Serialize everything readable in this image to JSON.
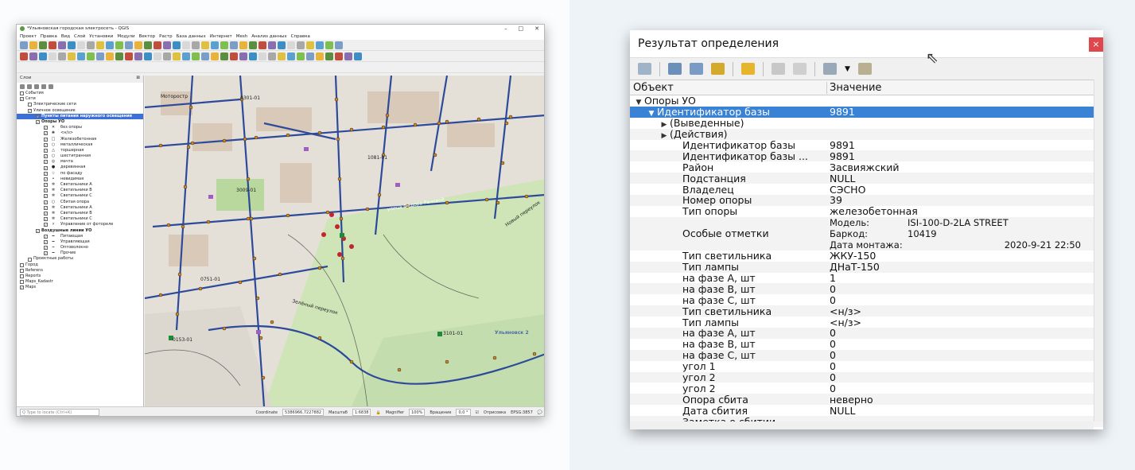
{
  "qgis": {
    "window_title": "*Ульяновская городская электросеть - QGIS",
    "menu": [
      "Проект",
      "Правка",
      "Вид",
      "Слой",
      "Установки",
      "Модули",
      "Вектор",
      "Растр",
      "База данных",
      "Интернет",
      "Mesh",
      "Анализ данных",
      "Справка"
    ],
    "panel_title": "Слои",
    "layers": [
      {
        "label": "События",
        "indent": 0,
        "sym": "",
        "check": ""
      },
      {
        "label": "Сети",
        "indent": 0,
        "sym": "",
        "check": "✓"
      },
      {
        "label": "Электрические сети",
        "indent": 1,
        "sym": "",
        "check": ""
      },
      {
        "label": "Уличное освещение",
        "indent": 1,
        "sym": "",
        "check": "✓"
      },
      {
        "label": "Пункты питания наружного освещения",
        "indent": 2,
        "sym": "",
        "check": "✓",
        "selected": true
      },
      {
        "label": "Опоры УО",
        "indent": 2,
        "sym": "",
        "check": "✓",
        "bold": true
      },
      {
        "label": "без опоры",
        "indent": 3,
        "sym": "✕",
        "check": "✓"
      },
      {
        "label": "<н/з>",
        "indent": 3,
        "sym": "❀",
        "check": "✓"
      },
      {
        "label": "Железобетонная",
        "indent": 3,
        "sym": "□",
        "check": "✓"
      },
      {
        "label": "металлическая",
        "indent": 3,
        "sym": "○",
        "check": "✓"
      },
      {
        "label": "торшерная",
        "indent": 3,
        "sym": "△",
        "check": "✓"
      },
      {
        "label": "шестигранная",
        "indent": 3,
        "sym": "○",
        "check": "✓"
      },
      {
        "label": "мачта",
        "indent": 3,
        "sym": "◎",
        "check": "✓"
      },
      {
        "label": "деревянная",
        "indent": 3,
        "sym": "●",
        "check": "✓"
      },
      {
        "label": "по фасаду",
        "indent": 3,
        "sym": "☆",
        "check": "✓"
      },
      {
        "label": "невидимая",
        "indent": 3,
        "sym": "•",
        "check": "✓"
      },
      {
        "label": "Светильники А",
        "indent": 3,
        "sym": "✲",
        "check": "✓"
      },
      {
        "label": "Светильники В",
        "indent": 3,
        "sym": "✲",
        "check": "✓"
      },
      {
        "label": "Светильники С",
        "indent": 3,
        "sym": "✲",
        "check": "✓"
      },
      {
        "label": "Сбитая опора",
        "indent": 3,
        "sym": "○",
        "check": "✓"
      },
      {
        "label": "Светильники А",
        "indent": 3,
        "sym": "✲",
        "check": "✓"
      },
      {
        "label": "Светильники В",
        "indent": 3,
        "sym": "✲",
        "check": "✓"
      },
      {
        "label": "Светильники С",
        "indent": 3,
        "sym": "✲",
        "check": "✓"
      },
      {
        "label": "Управление от фотореле",
        "indent": 3,
        "sym": "⚡",
        "check": "✓"
      },
      {
        "label": "Воздушные линии УО",
        "indent": 2,
        "sym": "",
        "check": "✓",
        "bold": true
      },
      {
        "label": "Питающая",
        "indent": 3,
        "sym": "━",
        "check": "✓"
      },
      {
        "label": "Управляющая",
        "indent": 3,
        "sym": "━",
        "check": "✓"
      },
      {
        "label": "Оптоволокно",
        "indent": 3,
        "sym": "┅",
        "check": "✓"
      },
      {
        "label": "Прочие",
        "indent": 3,
        "sym": "━",
        "check": "✓"
      },
      {
        "label": "Проектные работы",
        "indent": 1,
        "sym": "",
        "check": ""
      },
      {
        "label": "Город",
        "indent": 0,
        "sym": "",
        "check": ""
      },
      {
        "label": "Referens",
        "indent": 0,
        "sym": "",
        "check": ""
      },
      {
        "label": "Reports",
        "indent": 0,
        "sym": "",
        "check": ""
      },
      {
        "label": "Maps_Kadastr",
        "indent": 0,
        "sym": "",
        "check": ""
      },
      {
        "label": "Maps",
        "indent": 0,
        "sym": "",
        "check": "✓"
      }
    ],
    "map_labels": [
      "Моторостр",
      "0301-01",
      "1081-01",
      "3009-01",
      "0751-01",
      "3101-01",
      "0153-01",
      "Ульяновск 2",
      "Новый переулок",
      "Зелёный переулок",
      "улица Фёдора Раневой"
    ],
    "status": {
      "locate_placeholder": "Q  Type to locate (Ctrl+K)",
      "coordinate_label": "Coordinate",
      "coordinate_value": "5386966,7227882",
      "scale_label": "Масштаб",
      "scale_value": "1:6838",
      "magnifier_label": "Magnifier",
      "magnifier_value": "100%",
      "rotation_label": "Вращение",
      "rotation_value": "0,0 °",
      "render_label": "Отрисовка",
      "crs": "EPSG:3857"
    }
  },
  "identify": {
    "title": "Результат определения",
    "close": "×",
    "col_object": "Объект",
    "col_value": "Значение",
    "rows": [
      {
        "k": "Опоры УО",
        "v": "",
        "indent": 0,
        "arrow": "▼"
      },
      {
        "k": "Идентификатор базы",
        "v": "9891",
        "indent": 1,
        "arrow": "▼",
        "selected": true
      },
      {
        "k": "(Выведенные)",
        "v": "",
        "indent": 2,
        "arrow": "▶"
      },
      {
        "k": "(Действия)",
        "v": "",
        "indent": 2,
        "arrow": "▶"
      },
      {
        "k": "Идентификатор базы",
        "v": "9891",
        "indent": 3
      },
      {
        "k": "Идентификатор базы ...",
        "v": "9891",
        "indent": 3
      },
      {
        "k": "Район",
        "v": "Засвияжский",
        "indent": 3
      },
      {
        "k": "Подстанция",
        "v": "NULL",
        "indent": 3
      },
      {
        "k": "Владелец",
        "v": "СЭСНО",
        "indent": 3
      },
      {
        "k": "Номер опоры",
        "v": "39",
        "indent": 3
      },
      {
        "k": "Тип опоры",
        "v": "железобетонная",
        "indent": 3
      },
      {
        "k": "Особые отметки",
        "v": "",
        "indent": 3,
        "multi": true
      },
      {
        "k": "Тип светильника",
        "v": " ЖКУ-150",
        "indent": 3
      },
      {
        "k": "Тип лампы",
        "v": " ДНаТ-150",
        "indent": 3
      },
      {
        "k": "на фазе А, шт",
        "v": "1",
        "indent": 3
      },
      {
        "k": "на фазе B, шт",
        "v": "0",
        "indent": 3
      },
      {
        "k": "на фазе C, шт",
        "v": "0",
        "indent": 3
      },
      {
        "k": "Тип светильника",
        "v": "<н/з>",
        "indent": 3
      },
      {
        "k": "Тип лампы",
        "v": "<н/з>",
        "indent": 3
      },
      {
        "k": "на фазе А, шт",
        "v": "0",
        "indent": 3
      },
      {
        "k": "на фазе B, шт",
        "v": "0",
        "indent": 3
      },
      {
        "k": "на фазе C, шт",
        "v": "0",
        "indent": 3
      },
      {
        "k": "угол 1",
        "v": "0",
        "indent": 3
      },
      {
        "k": "угол 2",
        "v": "0",
        "indent": 3
      },
      {
        "k": "угол 2",
        "v": "0",
        "indent": 3
      },
      {
        "k": "Опора сбита",
        "v": "неверно",
        "indent": 3
      },
      {
        "k": "Дата сбития",
        "v": "NULL",
        "indent": 3
      },
      {
        "k": "Заметка о сбитии",
        "v": "",
        "indent": 3
      }
    ],
    "special": {
      "model_label": "Модель:",
      "model": "ISI-100-D-2LA STREET",
      "barcode_label": "Баркод:",
      "barcode": "10419",
      "date_label": "Дата монтажа:",
      "date": "2020-9-21 22:50"
    }
  },
  "colors": {
    "selection": "#3a82d5",
    "close": "#e0474c",
    "map_road": "#2d4a9a",
    "map_park": "#cde6b4"
  }
}
